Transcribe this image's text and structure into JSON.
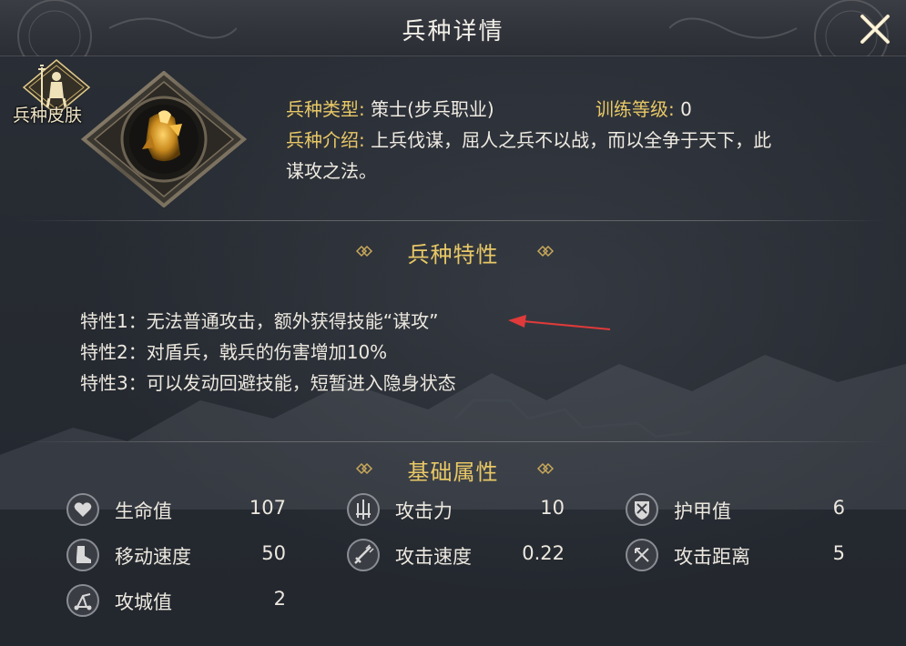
{
  "window": {
    "title": "兵种详情"
  },
  "skin": {
    "label": "兵种皮肤"
  },
  "unit": {
    "type_label": "兵种类型:",
    "type_value": "策士(步兵职业)",
    "train_label": "训练等级:",
    "train_value": "0",
    "intro_label": "兵种介绍:",
    "intro_line1": "上兵伐谋，屈人之兵不以战，而以全争于天下，此",
    "intro_line2": "谋攻之法。"
  },
  "traits_section": {
    "title": "兵种特性",
    "items": [
      "特性1：无法普通攻击，额外获得技能“谋攻”",
      "特性2：对盾兵，戟兵的伤害增加10%",
      "特性3：可以发动回避技能，短暂进入隐身状态"
    ]
  },
  "attrs_section": {
    "title": "基础属性",
    "stats": [
      {
        "name": "生命值",
        "value": "107",
        "icon": "heart-icon"
      },
      {
        "name": "攻击力",
        "value": "10",
        "icon": "crossed-swords-icon"
      },
      {
        "name": "护甲值",
        "value": "6",
        "icon": "shield-icon"
      },
      {
        "name": "移动速度",
        "value": "50",
        "icon": "boot-icon"
      },
      {
        "name": "攻击速度",
        "value": "0.22",
        "icon": "sword-speed-icon"
      },
      {
        "name": "攻击距离",
        "value": "5",
        "icon": "bow-range-icon"
      },
      {
        "name": "攻城值",
        "value": "2",
        "icon": "catapult-icon"
      }
    ]
  },
  "colors": {
    "accent_gold": "#e8c866",
    "annotation_arrow": "#e03a3a"
  }
}
